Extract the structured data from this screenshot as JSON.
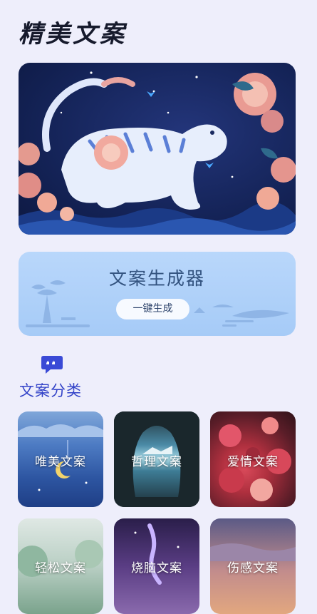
{
  "header": {
    "title": "精美文案"
  },
  "generator": {
    "title": "文案生成器",
    "button_label": "一键生成"
  },
  "categories": {
    "section_title": "文案分类",
    "items": [
      {
        "label": "唯美文案"
      },
      {
        "label": "哲理文案"
      },
      {
        "label": "爱情文案"
      },
      {
        "label": "轻松文案"
      },
      {
        "label": "烧脑文案"
      },
      {
        "label": "伤感文案"
      }
    ]
  },
  "colors": {
    "background": "#eeeefb",
    "accent": "#3343c8",
    "generator_card": "#a6cbf7"
  }
}
